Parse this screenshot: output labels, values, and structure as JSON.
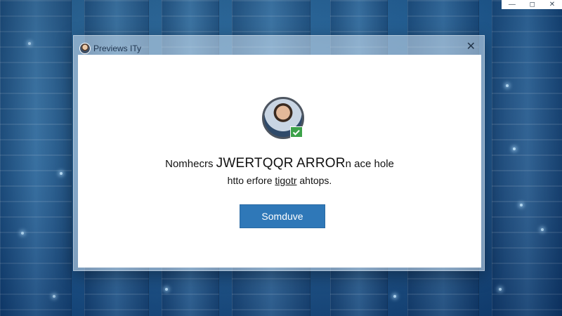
{
  "window_controls": {
    "minimize": "—",
    "maximize": "◻",
    "close": "✕"
  },
  "dialog": {
    "title": "Previews ITy",
    "close_glyph": "✕",
    "message_line1_pre": "Nomhecrs ",
    "message_line1_bold": "JWERTQQR ARROR",
    "message_line1_post": "n ace hole",
    "message_line2_pre": "htto erfore ",
    "message_line2_underlined": "tigotr",
    "message_line2_post": " ahtops.",
    "button_label": "Somduve"
  },
  "colors": {
    "accent": "#2f78b8",
    "badge": "#3ca24a",
    "background": "#1f5f96"
  },
  "icons": {
    "avatar": "user-avatar-icon",
    "badge": "checkmark-badge-icon",
    "close": "close-icon"
  }
}
